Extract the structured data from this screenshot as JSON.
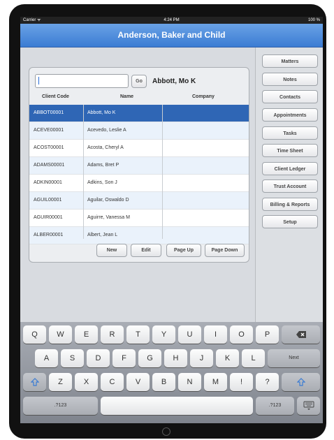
{
  "status_bar": {
    "carrier": "Carrier ᯤ",
    "time": "4:24 PM",
    "battery": "100 %"
  },
  "app": {
    "title": "Anderson, Baker and Child"
  },
  "search": {
    "value": "",
    "go_label": "Go"
  },
  "selected_client": "Abbott, Mo K",
  "table": {
    "columns": [
      "Client Code",
      "Name",
      "Company"
    ],
    "rows": [
      {
        "code": "ABBOT00001",
        "name": "Abbott, Mo K",
        "company": ""
      },
      {
        "code": "ACEVE00001",
        "name": "Acevedo, Leslie A",
        "company": ""
      },
      {
        "code": "ACOST00001",
        "name": "Acosta, Cheryl A",
        "company": ""
      },
      {
        "code": "ADAMS00001",
        "name": "Adams, Bret P",
        "company": ""
      },
      {
        "code": "ADKIN00001",
        "name": "Adkins, Son J",
        "company": ""
      },
      {
        "code": "AGUIL00001",
        "name": "Aguilar, Oswaldo D",
        "company": ""
      },
      {
        "code": "AGUIR00001",
        "name": "Aguirre, Vanessa M",
        "company": ""
      },
      {
        "code": "ALBER00001",
        "name": "Albert, Jean L",
        "company": ""
      }
    ],
    "selected_index": 0
  },
  "bottom_buttons": {
    "new": "New",
    "edit": "Edit",
    "page_up": "Page Up",
    "page_down": "Page Down"
  },
  "sidebar": {
    "items": [
      "Matters",
      "Notes",
      "Contacts",
      "Appointments",
      "Tasks",
      "Time Sheet",
      "Client Ledger",
      "Trust Account",
      "Billing & Reports",
      "Setup"
    ]
  },
  "keyboard": {
    "row1": [
      "Q",
      "W",
      "E",
      "R",
      "T",
      "Y",
      "U",
      "I",
      "O",
      "P"
    ],
    "backspace_icon": "backspace-icon",
    "row2": [
      "A",
      "S",
      "D",
      "F",
      "G",
      "H",
      "J",
      "K",
      "L"
    ],
    "return_label": "Next",
    "row3": [
      "Z",
      "X",
      "C",
      "V",
      "B",
      "N",
      "M",
      "!",
      "?"
    ],
    "shift_icon": "shift-icon",
    "numbers_label": ".?123",
    "hide_icon": "keyboard-hide-icon"
  }
}
